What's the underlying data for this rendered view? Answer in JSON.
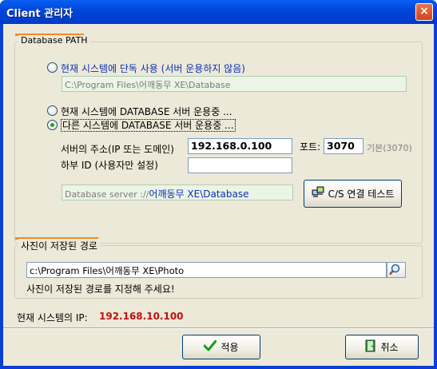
{
  "window": {
    "title": "Client 관리자",
    "close_glyph": "×"
  },
  "db_group": {
    "legend": "Database PATH",
    "options": [
      {
        "label": "현재 시스템에 단독 사용 (서버 운용하지 않음)",
        "selected": false
      },
      {
        "label": "현재 시스템에 DATABASE 서버 운용중 ...",
        "selected": false
      },
      {
        "label": "다른 시스템에 DATABASE 서버 운용중 ...",
        "selected": true
      }
    ],
    "local_path": "C:\\Program Files\\어깨동무 XE\\Database",
    "server_address_label": "서버의 주소(IP 또는 도메인)",
    "server_address_value": "192.168.0.100",
    "port_label": "포트:",
    "port_value": "3070",
    "port_default": "기본(3070)",
    "sub_id_label": "하부 ID (사용자만 설정)",
    "sub_id_value": "",
    "server_path_prefix": "Database server ://",
    "server_path_value": "어깨동무 XE\\Database",
    "test_button": "C/S 연결 테스트"
  },
  "photo_group": {
    "legend": "사진이 저장된 경로",
    "path": "c:\\Program Files\\어깨동무 XE\\Photo",
    "hint": "사진이 저장된 경로를 지정해 주세요!"
  },
  "footer": {
    "ip_label": "현재 시스템의 IP:",
    "ip_value": "192.168.10.100",
    "apply_button": "적용",
    "cancel_button": "취소"
  },
  "icons": {
    "apply": "check-icon",
    "cancel": "exit-door-icon",
    "test": "network-computers-icon",
    "browse": "magnifier-icon"
  },
  "colors": {
    "titlebar": "#0040d0",
    "dialog_bg": "#ece9d8",
    "legend_accent": "#f08a2a",
    "ip_value": "#c01010",
    "link_blue": "#0b2eb3"
  }
}
